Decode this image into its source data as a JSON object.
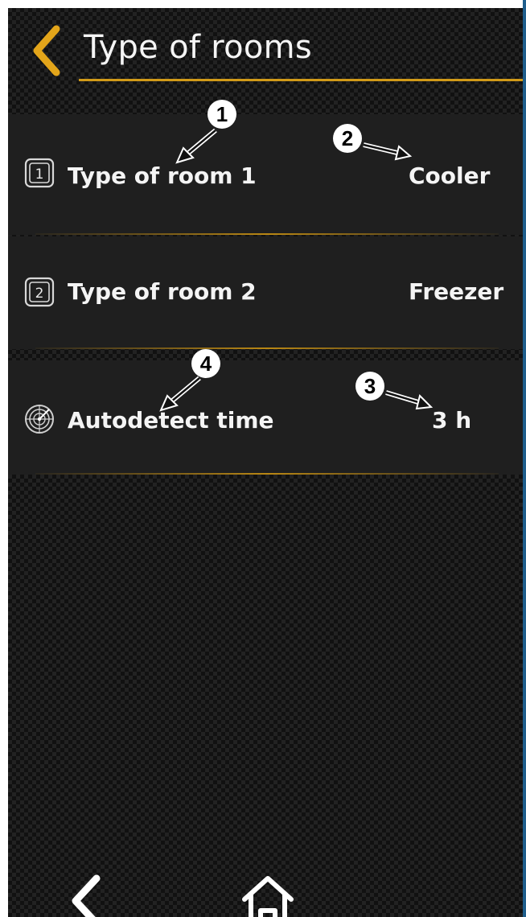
{
  "header": {
    "title": "Type of rooms",
    "back_icon": "chevron-left-icon",
    "accent_color": "#d19a18"
  },
  "rows": [
    {
      "icon": "number-1-icon",
      "icon_text": "1",
      "label": "Type of room 1",
      "value": "Cooler"
    },
    {
      "icon": "number-2-icon",
      "icon_text": "2",
      "label": "Type of room 2",
      "value": "Freezer"
    },
    {
      "icon": "radar-icon",
      "label": "Autodetect time",
      "value": "3 h"
    }
  ],
  "callouts": [
    "1",
    "2",
    "3",
    "4"
  ],
  "nav": {
    "back_icon": "chevron-left-icon",
    "home_icon": "home-icon"
  }
}
